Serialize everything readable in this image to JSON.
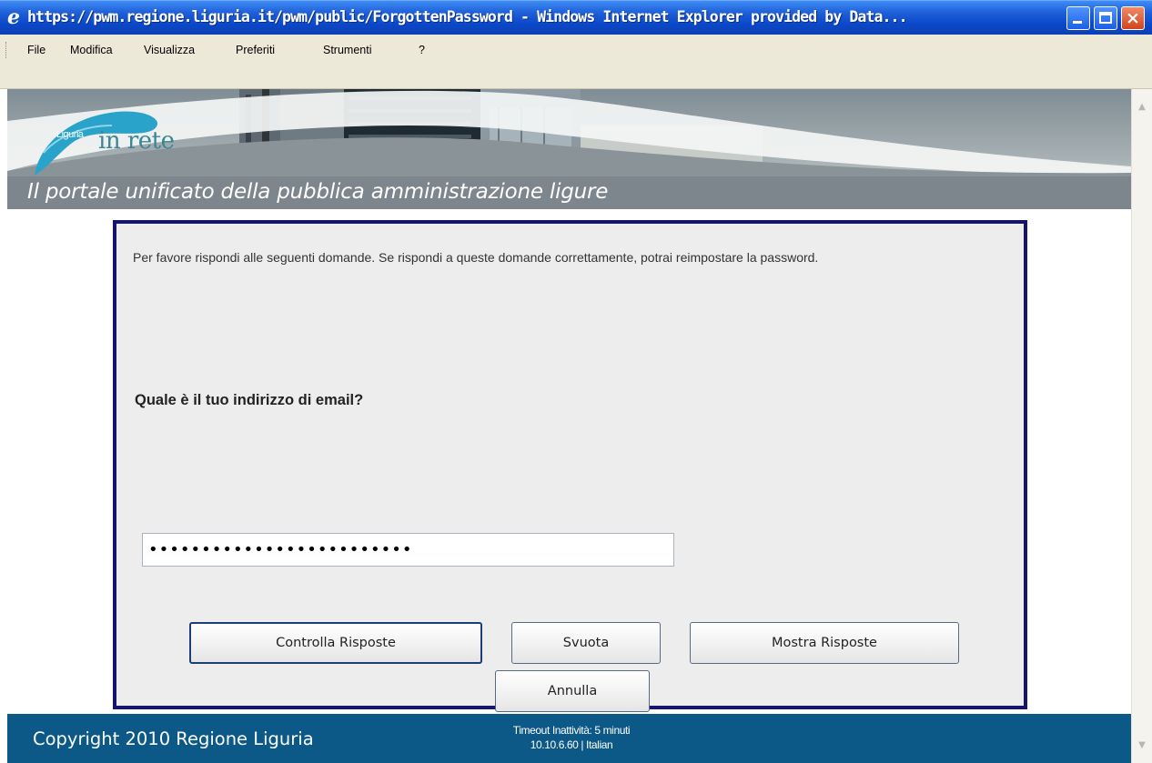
{
  "window": {
    "title": "https://pwm.regione.liguria.it/pwm/public/ForgottenPassword - Windows Internet Explorer provided by Data...",
    "buttons": {
      "minimize": "minimize",
      "maximize": "maximize",
      "close": "×"
    }
  },
  "menu": {
    "items": [
      "File",
      "Modifica",
      "Visualizza",
      "Preferiti",
      "Strumenti",
      "?"
    ]
  },
  "banner": {
    "logo_small": "Liguria",
    "logo_big": "in rete",
    "tagline": "Il portale unificato della pubblica amministrazione ligure"
  },
  "form": {
    "intro": "Per favore rispondi alle seguenti domande. Se rispondi a queste domande correttamente, potrai reimpostare la password.",
    "question": "Quale è il tuo indirizzo di email?",
    "answer_masked": "•••••••••••••••••••••••••",
    "buttons": {
      "check": "Controlla Risposte",
      "clear": "Svuota",
      "show": "Mostra Risposte",
      "cancel": "Annulla"
    }
  },
  "footer": {
    "copyright": "Copyright 2010 Regione Liguria",
    "timeout": "Timeout Inattività: 5 minuti",
    "server_info": "10.10.6.60 | Italian"
  },
  "colors": {
    "panel_border": "#17156b",
    "footer_bg": "#0c5988",
    "titlebar": "#0a48c9"
  }
}
